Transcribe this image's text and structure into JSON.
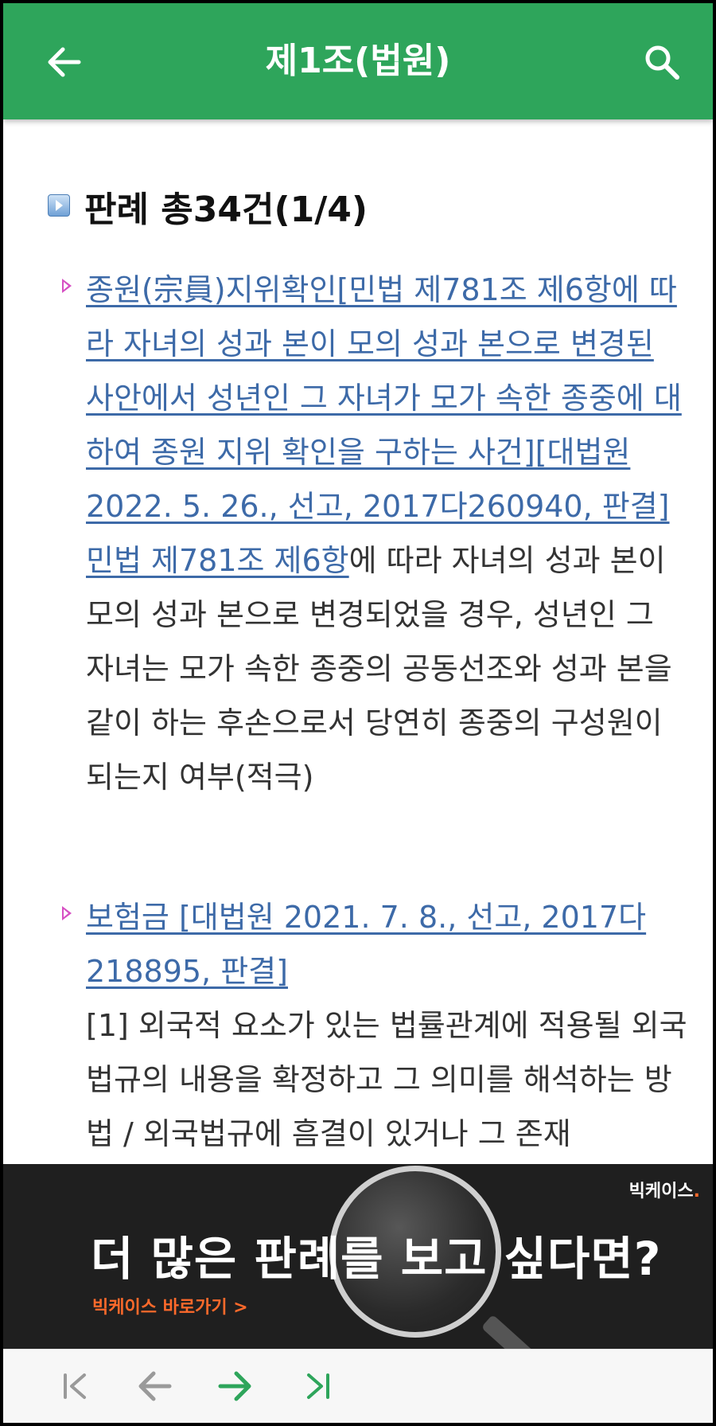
{
  "header": {
    "title": "제1조(법원)",
    "back_icon": "arrow-left-icon",
    "search_icon": "search-icon",
    "color": "#2ea55b"
  },
  "section": {
    "heading": "판례 총34건(1/4)"
  },
  "cases": [
    {
      "link": "종원(宗員)지위확인[민법 제781조 제6항에 따라 자녀의 성과 본이 모의 성과 본으로 변경된 사안에서 성년인 그 자녀가 모가 속한 종중에 대하여 종원 지위 확인을 구하는 사건][대법원 2022. 5. 26., 선고, 2017다260940, 판결]",
      "body_link": "민법 제781조 제6항",
      "body": "에 따라 자녀의 성과 본이 모의 성과 본으로 변경되었을 경우, 성년인 그 자녀는 모가 속한 종중의 공동선조와 성과 본을 같이 하는 후손으로서 당연히 종중의 구성원이 되는지 여부(적극)"
    },
    {
      "link": "보험금 [대법원 2021. 7. 8., 선고, 2017다218895, 판결]",
      "body": "[1] 외국적 요소가 있는 법률관계에 적용될 외국법규의 내용을 확정하고 그 의미를 해석하는 방법 / 외국법규에 흠결이 있거나 그 존재"
    }
  ],
  "banner": {
    "brand": "빅케이스",
    "brand_dot": ".",
    "headline": "더 많은 판례를 보고 싶다면?",
    "cta": "빅케이스 바로가기 >"
  },
  "bottom_nav": {
    "first_icon": "first-page-icon",
    "prev_icon": "arrow-left-icon",
    "next_icon": "arrow-right-icon",
    "last_icon": "last-page-icon",
    "active_color": "#2ea55b",
    "inactive_color": "#9a9a9a"
  }
}
